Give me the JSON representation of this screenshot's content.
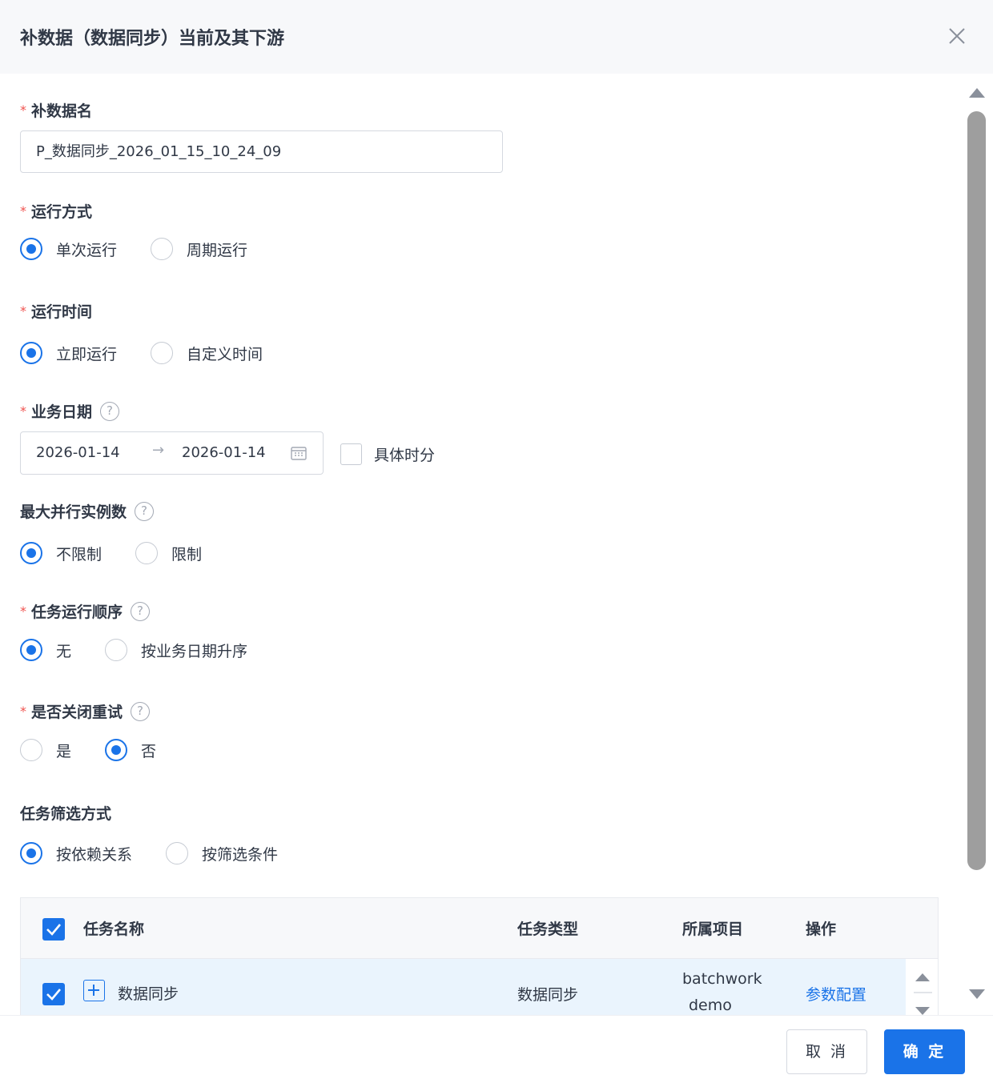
{
  "dialog": {
    "title": "补数据（数据同步）当前及其下游",
    "cancel_label": "取 消",
    "ok_label": "确 定"
  },
  "form": {
    "name": {
      "label": "补数据名",
      "value": "P_数据同步_2026_01_15_10_24_09"
    },
    "run_mode": {
      "label": "运行方式",
      "options": [
        "单次运行",
        "周期运行"
      ],
      "selected": "单次运行"
    },
    "run_time": {
      "label": "运行时间",
      "options": [
        "立即运行",
        "自定义时间"
      ],
      "selected": "立即运行"
    },
    "biz_date": {
      "label": "业务日期",
      "start": "2026-01-14",
      "end": "2026-01-14",
      "arrow": "→",
      "detail_time_label": "具体时分",
      "detail_time_checked": false
    },
    "max_parallel": {
      "label": "最大并行实例数",
      "options": [
        "不限制",
        "限制"
      ],
      "selected": "不限制"
    },
    "run_order": {
      "label": "任务运行顺序",
      "options": [
        "无",
        "按业务日期升序"
      ],
      "selected": "无"
    },
    "close_retry": {
      "label": "是否关闭重试",
      "options": [
        "是",
        "否"
      ],
      "selected": "否"
    },
    "filter_mode": {
      "label": "任务筛选方式",
      "options": [
        "按依赖关系",
        "按筛选条件"
      ],
      "selected": "按依赖关系"
    }
  },
  "table": {
    "columns": [
      "任务名称",
      "任务类型",
      "所属项目",
      "操作"
    ],
    "rows": [
      {
        "name": "数据同步",
        "type": "数据同步",
        "project_line1": "batchwork",
        "project_line2": "demo",
        "action": "参数配置",
        "checked": true
      }
    ]
  },
  "icons": {
    "close": "close-icon",
    "help": "question-circle-icon",
    "calendar": "calendar-icon",
    "check": "check-icon",
    "expand": "plus-square-icon"
  },
  "colors": {
    "primary": "#1a73e8",
    "required": "#f0534f",
    "row_highlight": "#eaf4fd"
  }
}
